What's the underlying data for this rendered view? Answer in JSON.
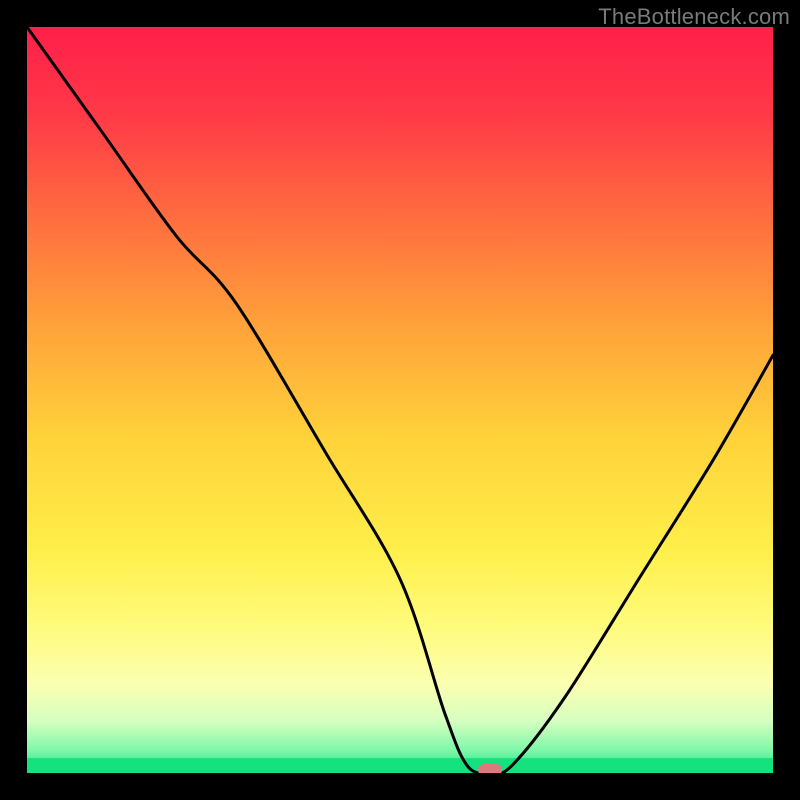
{
  "watermark": "TheBottleneck.com",
  "colors": {
    "frame": "#000000",
    "curve": "#000000",
    "marker": "#d97b7f",
    "gradient_stops": [
      {
        "offset": 0.0,
        "color": "#ff1f4a"
      },
      {
        "offset": 0.12,
        "color": "#ff3a47"
      },
      {
        "offset": 0.25,
        "color": "#ff6b3f"
      },
      {
        "offset": 0.4,
        "color": "#ffa23a"
      },
      {
        "offset": 0.55,
        "color": "#ffd23a"
      },
      {
        "offset": 0.7,
        "color": "#ffef4a"
      },
      {
        "offset": 0.8,
        "color": "#fffb7a"
      },
      {
        "offset": 0.88,
        "color": "#fbffb0"
      },
      {
        "offset": 0.93,
        "color": "#d6ffc0"
      },
      {
        "offset": 0.97,
        "color": "#7ef8a8"
      },
      {
        "offset": 1.0,
        "color": "#13e27e"
      }
    ]
  },
  "chart_data": {
    "type": "line",
    "title": "",
    "xlabel": "",
    "ylabel": "",
    "xlim": [
      0,
      100
    ],
    "ylim": [
      0,
      100
    ],
    "grid": false,
    "legend": false,
    "series": [
      {
        "name": "bottleneck-curve",
        "x": [
          0,
          10,
          20,
          28,
          40,
          50,
          56,
          59,
          62,
          65,
          72,
          82,
          92,
          100
        ],
        "y": [
          100,
          86,
          72,
          63,
          43,
          26,
          8,
          1,
          0,
          1,
          10,
          26,
          42,
          56
        ]
      }
    ],
    "marker": {
      "x": 62,
      "y": 0
    },
    "green_band": {
      "y_min": 0,
      "y_max": 2
    }
  }
}
